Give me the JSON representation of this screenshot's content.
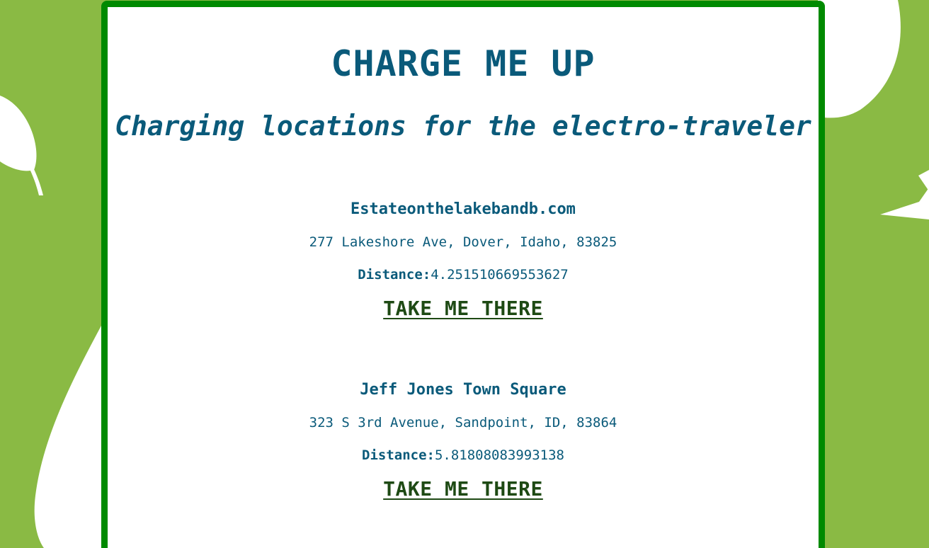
{
  "header": {
    "title": "CHARGE ME UP",
    "tagline": "Charging locations for the electro-traveler"
  },
  "locations": [
    {
      "name": "Estateonthelakebandb.com",
      "address": "277 Lakeshore Ave, Dover, Idaho, 83825",
      "distance_label": "Distance:",
      "distance_value": "4.251510669553627",
      "link_label": "TAKE ME THERE"
    },
    {
      "name": "Jeff Jones Town Square",
      "address": "323 S 3rd Avenue, Sandpoint, ID, 83864",
      "distance_label": "Distance:",
      "distance_value": "5.81808083993138",
      "link_label": "TAKE ME THERE"
    }
  ],
  "colors": {
    "background": "#8aba44",
    "panel_border": "#008a00",
    "heading_text": "#0a5a7a",
    "link_text": "#1e4a14",
    "leaf_shapes": "#ffffff"
  }
}
